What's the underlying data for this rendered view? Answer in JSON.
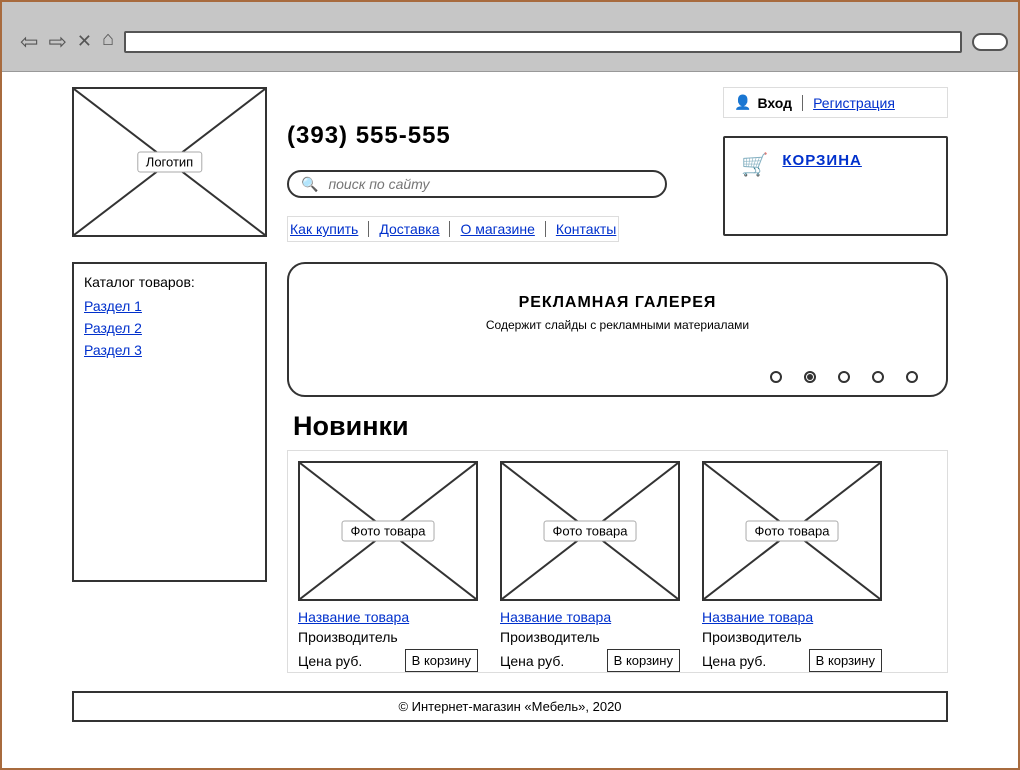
{
  "header": {
    "logo_label": "Логотип",
    "phone": "(393) 555-555",
    "search_placeholder": "поиск по сайту",
    "info_links": [
      "Как купить",
      "Доставка",
      "О магазине",
      "Контакты"
    ]
  },
  "auth": {
    "login_label": "Вход",
    "register_label": "Регистрация"
  },
  "cart": {
    "label": "КОРЗИНА"
  },
  "catalog": {
    "title": "Каталог товаров:",
    "sections": [
      "Раздел 1",
      "Раздел 2",
      "Раздел 3"
    ]
  },
  "banner": {
    "title": "РЕКЛАМНАЯ ГАЛЕРЕЯ",
    "subtitle": "Содержит слайды с рекламными материалами",
    "dot_count": 5,
    "active_dot": 1
  },
  "new_section": {
    "title": "Новинки"
  },
  "products": [
    {
      "photo_label": "Фото товара",
      "name": "Название товара",
      "maker": "Производитель",
      "price": "Цена руб.",
      "btn": "В корзину"
    },
    {
      "photo_label": "Фото товара",
      "name": "Название товара",
      "maker": "Производитель",
      "price": "Цена руб.",
      "btn": "В корзину"
    },
    {
      "photo_label": "Фото товара",
      "name": "Название товара",
      "maker": "Производитель",
      "price": "Цена руб.",
      "btn": "В корзину"
    }
  ],
  "footer": {
    "text": "© Интернет-магазин «Мебель», 2020"
  }
}
